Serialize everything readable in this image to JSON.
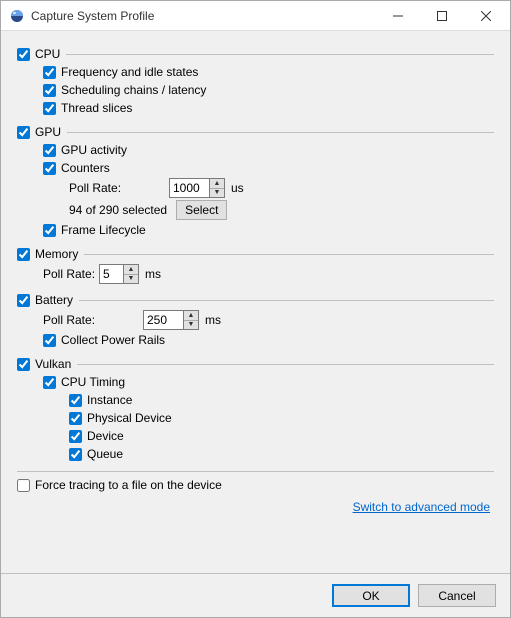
{
  "window": {
    "title": "Capture System Profile"
  },
  "cpu": {
    "label": "CPU",
    "checked": true,
    "freq_idle": {
      "label": "Frequency and idle states",
      "checked": true
    },
    "sched_chains": {
      "label": "Scheduling chains / latency",
      "checked": true
    },
    "thread_slices": {
      "label": "Thread slices",
      "checked": true
    }
  },
  "gpu": {
    "label": "GPU",
    "checked": true,
    "activity": {
      "label": "GPU activity",
      "checked": true
    },
    "counters": {
      "label": "Counters",
      "checked": true,
      "poll_label": "Poll Rate:",
      "poll_value": "1000",
      "poll_unit": "us",
      "selected_text": "94 of 290 selected",
      "select_btn": "Select"
    },
    "frame_lifecycle": {
      "label": "Frame Lifecycle",
      "checked": true
    }
  },
  "memory": {
    "label": "Memory",
    "checked": true,
    "poll_label": "Poll Rate:",
    "poll_value": "5",
    "poll_unit": "ms"
  },
  "battery": {
    "label": "Battery",
    "checked": true,
    "poll_label": "Poll Rate:",
    "poll_value": "250",
    "poll_unit": "ms",
    "power_rails": {
      "label": "Collect Power Rails",
      "checked": true
    }
  },
  "vulkan": {
    "label": "Vulkan",
    "checked": true,
    "cpu_timing": {
      "label": "CPU Timing",
      "checked": true,
      "instance": {
        "label": "Instance",
        "checked": true
      },
      "physical_device": {
        "label": "Physical Device",
        "checked": true
      },
      "device": {
        "label": "Device",
        "checked": true
      },
      "queue": {
        "label": "Queue",
        "checked": true
      }
    }
  },
  "force_trace": {
    "label": "Force tracing to a file on the device",
    "checked": false
  },
  "advanced_link": "Switch to advanced mode",
  "footer": {
    "ok": "OK",
    "cancel": "Cancel"
  }
}
